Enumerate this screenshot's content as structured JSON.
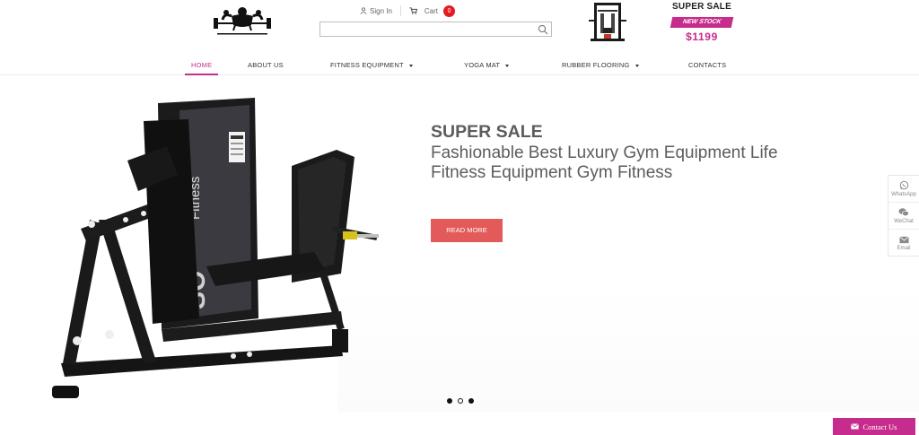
{
  "header": {
    "logo_alt": "gym logo",
    "sign_in": "Sign In",
    "cart_label": "Cart",
    "cart_count": "0",
    "search": {
      "value": "",
      "placeholder": ""
    }
  },
  "promo": {
    "title": "SUPER SALE",
    "badge": "NEW STOCK",
    "price": "$1199"
  },
  "nav": {
    "items": [
      {
        "label": "HOME",
        "active": true,
        "dropdown": false
      },
      {
        "label": "ABOUT US",
        "active": false,
        "dropdown": false
      },
      {
        "label": "FITNESS EQUIPMENT",
        "active": false,
        "dropdown": true
      },
      {
        "label": "YOGA MAT",
        "active": false,
        "dropdown": true
      },
      {
        "label": "RUBBER FLOORING",
        "active": false,
        "dropdown": true
      },
      {
        "label": "CONTACTS",
        "active": false,
        "dropdown": false
      }
    ]
  },
  "hero": {
    "kicker": "SUPER SALE",
    "title": "Fashionable Best Luxury Gym Equipment Life Fitness Equipment Gym Fitness",
    "button": "READ MORE",
    "machine_text": "SO Fitness",
    "slides_count": 3,
    "active_slide": 2
  },
  "float_bar": {
    "items": [
      {
        "label": "WhatsApp",
        "icon": "whatsapp-icon"
      },
      {
        "label": "WeChat",
        "icon": "wechat-icon"
      },
      {
        "label": "Email",
        "icon": "email-icon"
      }
    ]
  },
  "contact": {
    "label": "Contact Us"
  },
  "colors": {
    "brand": "#c62c8d",
    "button": "#e35a5a",
    "cart_badge": "#e31b23",
    "text": "#5c5c5c"
  }
}
